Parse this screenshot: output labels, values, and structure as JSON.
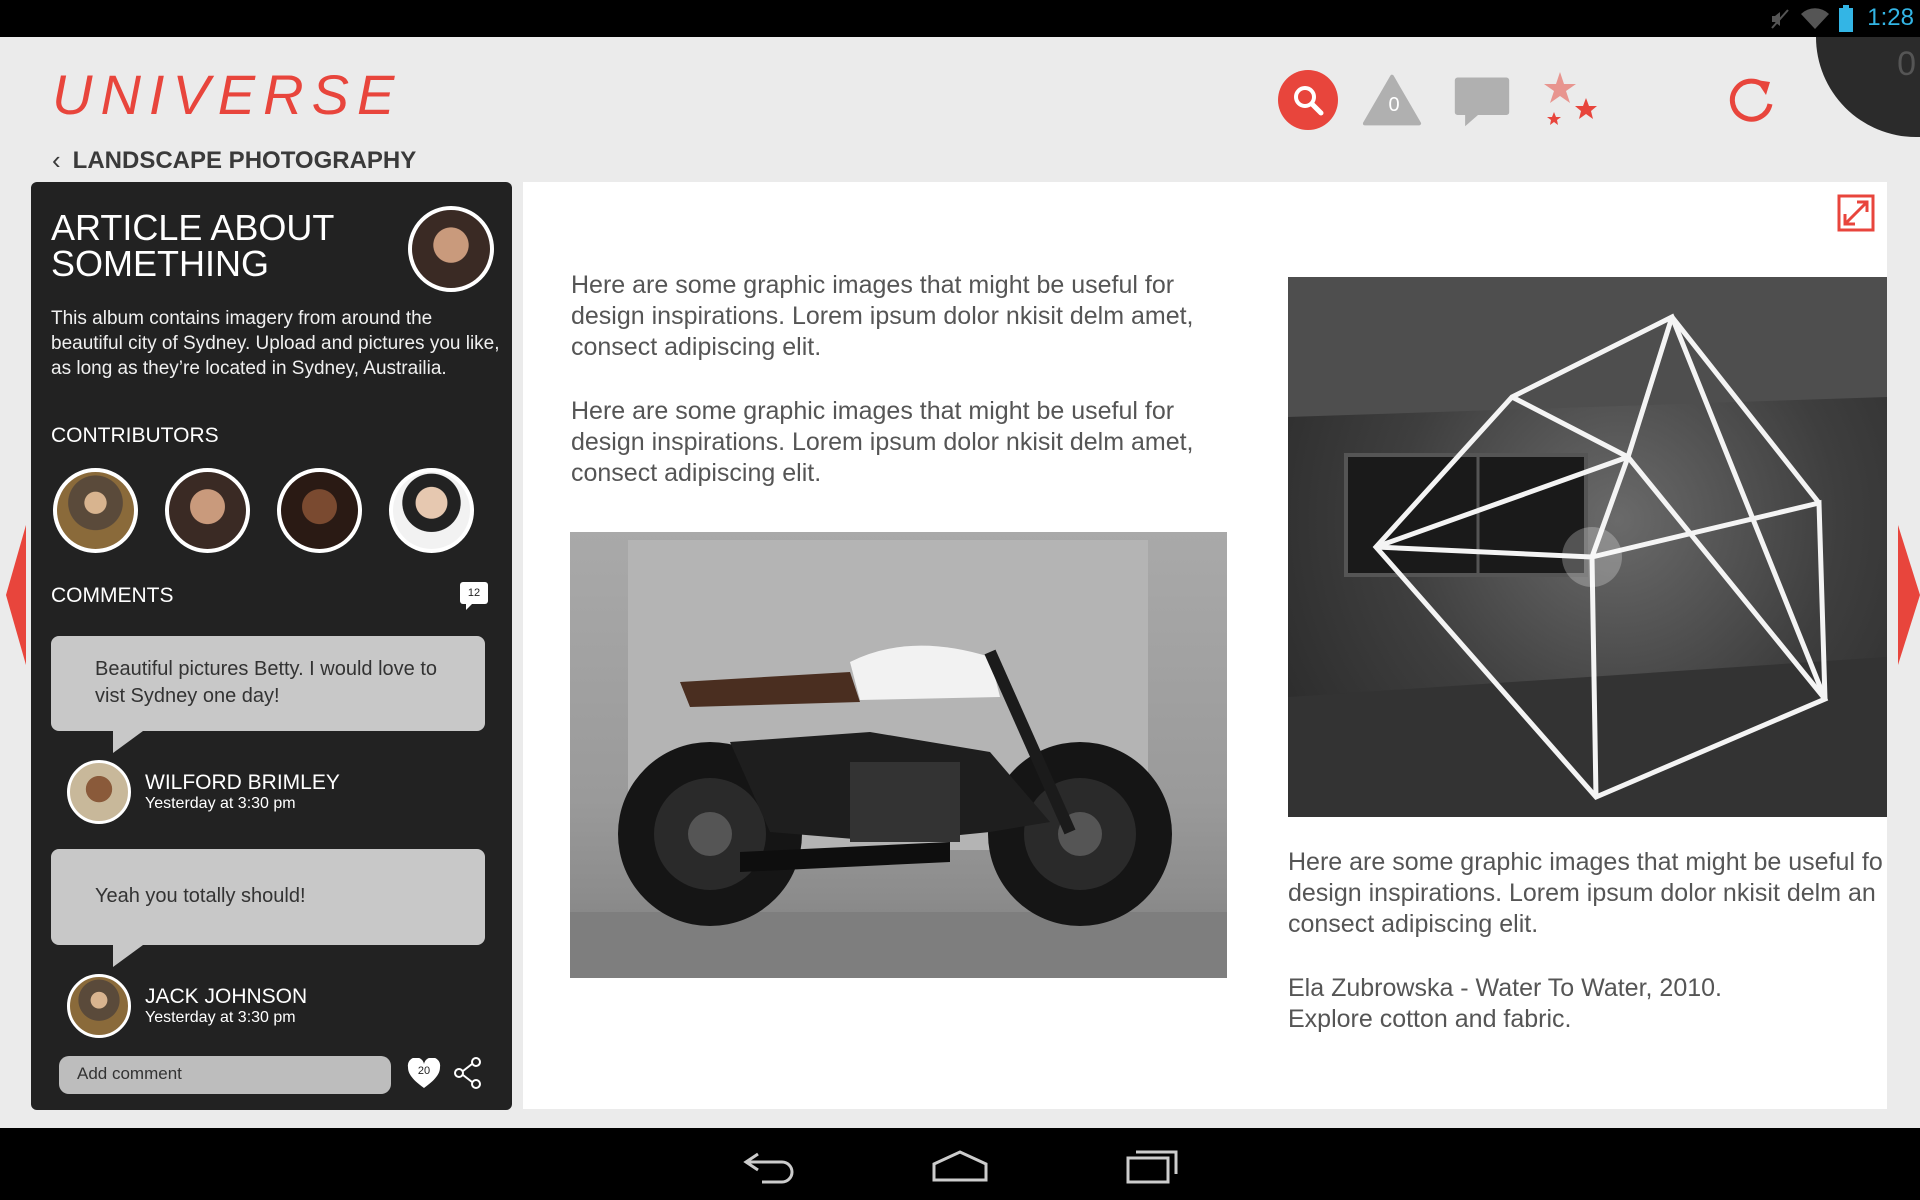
{
  "status_bar": {
    "time": "1:28",
    "icons": [
      "mute-icon",
      "wifi-icon",
      "battery-icon"
    ]
  },
  "app": {
    "logo_text": "UNIVERSE",
    "breadcrumb": "LANDSCAPE PHOTOGRAPHY",
    "accent_color": "#e8453c",
    "header_icons": [
      "search-icon",
      "alert-icon",
      "chat-icon",
      "stars-icon",
      "refresh-icon"
    ],
    "alert_count": "0",
    "corner_count": "0"
  },
  "sidebar": {
    "title": "ARTICLE ABOUT SOMETHING",
    "description": "This album contains imagery from around the beautiful city of Sydney. Upload and pictures you like, as long as they’re located in Sydney, Austrailia.",
    "contributors_label": "CONTRIBUTORS",
    "comments_label": "COMMENTS",
    "comment_count": "12",
    "comments": [
      {
        "text": "Beautiful pictures Betty. I would love to vist Sydney one day!",
        "name": "WILFORD BRIMLEY",
        "time": "Yesterday at 3:30 pm"
      },
      {
        "text": "Yeah you totally should!",
        "name": "JACK JOHNSON",
        "time": "Yesterday at 3:30 pm"
      }
    ],
    "add_comment_placeholder": "Add comment",
    "like_count": "20"
  },
  "content": {
    "paragraph_1": "Here are some graphic images that might be useful for design inspirations. Lorem ipsum dolor nkisit delm amet, consect adipiscing elit.",
    "paragraph_2": "Here are some graphic images that might be useful for design inspirations. Lorem ipsum dolor nkisit delm amet, consect adipiscing elit.",
    "paragraph_3_lines": [
      "Here are some graphic images that might be useful fo",
      "design inspirations. Lorem ipsum dolor nkisit delm an",
      "consect adipiscing elit."
    ],
    "caption_line_1": "Ela Zubrowska - Water To Water, 2010.",
    "caption_line_2": "Explore cotton and fabric."
  }
}
